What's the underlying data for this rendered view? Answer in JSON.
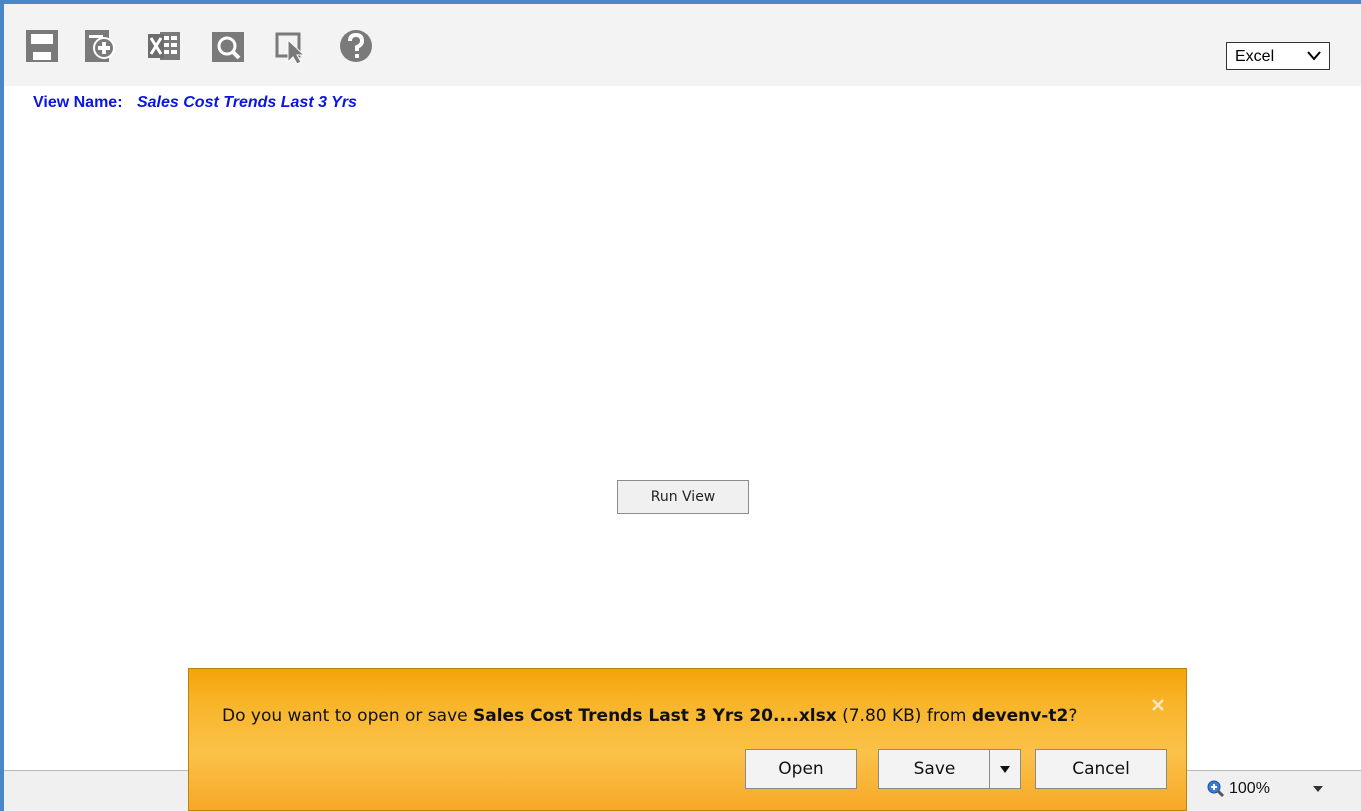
{
  "toolbar": {
    "icons": [
      "save-icon",
      "add-view-icon",
      "excel-export-icon",
      "preview-icon",
      "select-pointer-icon",
      "help-icon"
    ],
    "format_select": {
      "value": "Excel"
    }
  },
  "view": {
    "name_label": "View Name:",
    "name_value": "Sales Cost Trends Last 3 Yrs"
  },
  "run_button": {
    "label": "Run View"
  },
  "notification": {
    "prefix": "Do you want to open or save ",
    "filename": "Sales Cost Trends Last 3 Yrs 20....xlsx",
    "size": " (7.80 KB) from ",
    "source": "devenv-t2",
    "suffix": "?",
    "open_label": "Open",
    "save_label": "Save",
    "cancel_label": "Cancel"
  },
  "status_bar": {
    "zoom": "100%"
  },
  "colors": {
    "accent_frame": "#4a86c8",
    "view_name_blue": "#0a14e6",
    "notification_orange": "#f8b52a"
  }
}
